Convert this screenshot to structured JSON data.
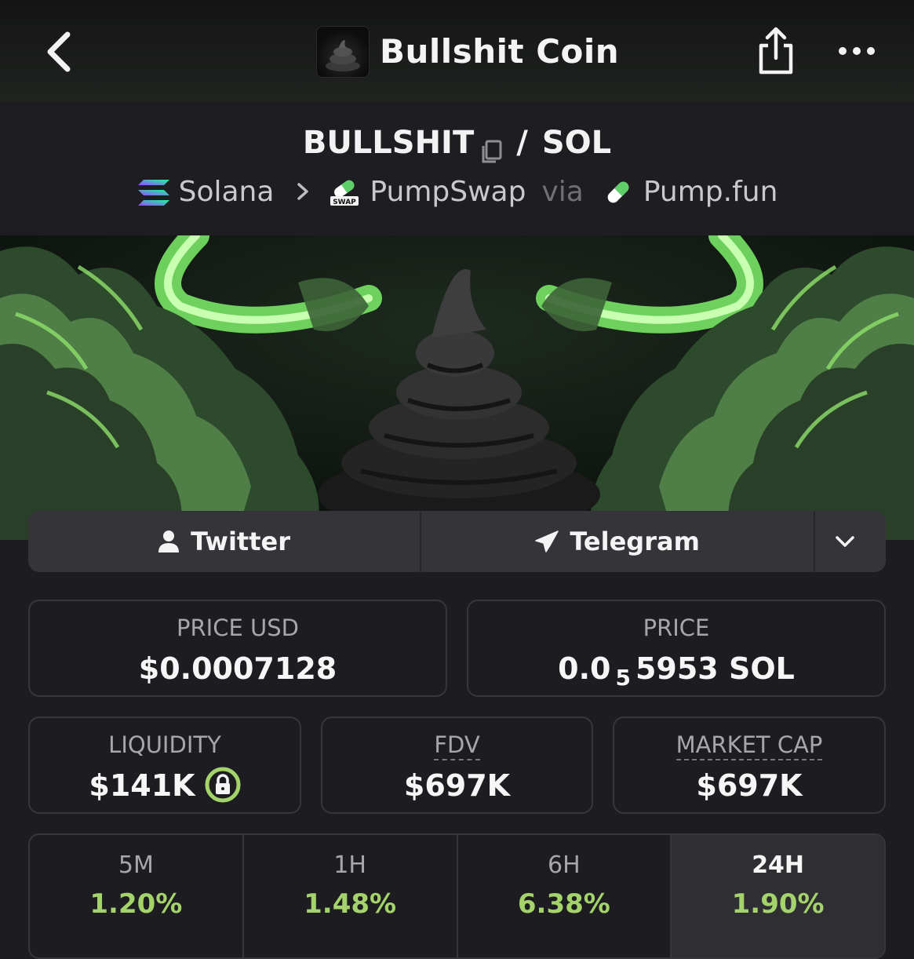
{
  "header": {
    "title": "Bullshit Coin",
    "back_icon": "chevron-left-icon",
    "share_icon": "share-icon",
    "more_icon": "more-horizontal-icon"
  },
  "pair": {
    "base": "BULLSHIT",
    "separator": "/",
    "quote": "SOL",
    "chain": "Solana",
    "dex": "PumpSwap",
    "via": "via",
    "launchpad": "Pump.fun",
    "dex_badge": "SWAP"
  },
  "social": {
    "twitter": "Twitter",
    "telegram": "Telegram"
  },
  "stats": {
    "price_usd_label": "PRICE USD",
    "price_usd": "$0.0007128",
    "price_label": "PRICE",
    "price_prefix": "0.0",
    "price_zeros": "5",
    "price_suffix": "5953 SOL",
    "liquidity_label": "LIQUIDITY",
    "liquidity": "$141K",
    "fdv_label": "FDV",
    "fdv": "$697K",
    "mcap_label": "MARKET CAP",
    "mcap": "$697K"
  },
  "changes": [
    {
      "label": "5M",
      "value": "1.20%",
      "active": false
    },
    {
      "label": "1H",
      "value": "1.48%",
      "active": false
    },
    {
      "label": "6H",
      "value": "6.38%",
      "active": false
    },
    {
      "label": "24H",
      "value": "1.90%",
      "active": true
    }
  ],
  "colors": {
    "positive": "#a3d36a",
    "accent_green": "#8ee06c",
    "background": "#1d1d21"
  }
}
